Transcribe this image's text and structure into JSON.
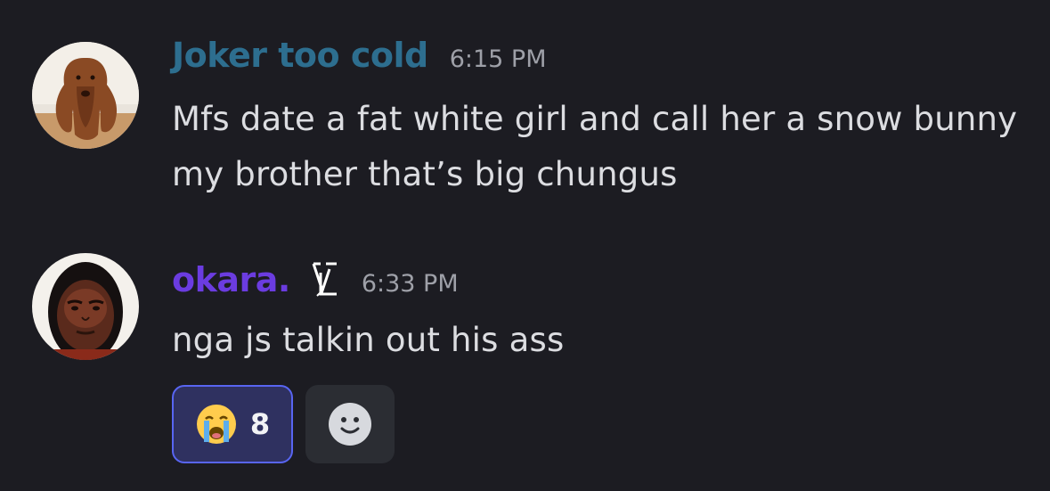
{
  "messages": [
    {
      "author": "Joker too cold",
      "author_color": "#2d6e8f",
      "timestamp": "6:15 PM",
      "avatar": "bloodhound-dog-avatar",
      "text": "Mfs date a fat white girl and call her a snow bunny my brother that’s big chungus"
    },
    {
      "author": "okara.",
      "author_color": "#6b3ce0",
      "timestamp": "6:33 PM",
      "avatar": "person-portrait-avatar",
      "badge_icon": "lv-monogram-icon",
      "text": "nga js talkin out his ass",
      "reactions": [
        {
          "emoji": "😭",
          "emoji_name": "loudly-crying-face",
          "count": "8",
          "active": true
        }
      ],
      "add_reaction_icon": "smiley-face-icon"
    }
  ],
  "colors": {
    "background": "#1c1c22",
    "text": "#dcdde1",
    "timestamp": "#9ea0a8",
    "reaction_active_bg": "#2f3160",
    "reaction_active_border": "#5865f2"
  }
}
